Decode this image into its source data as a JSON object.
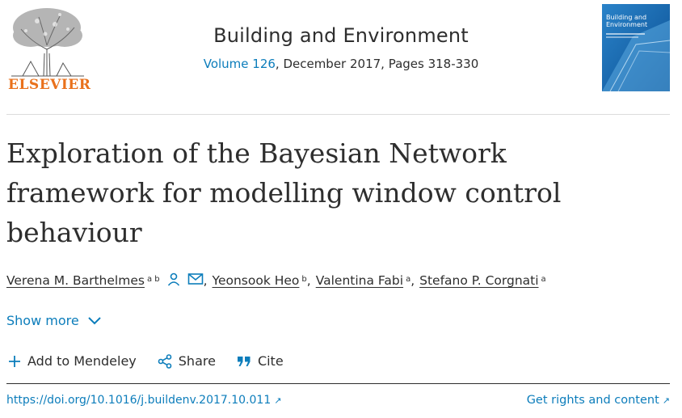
{
  "header": {
    "publisher": "ELSEVIER",
    "journal_title": "Building and Environment",
    "volume_link": "Volume 126",
    "volume_rest": ", December 2017, Pages 318-330",
    "cover_title": "Building and Environment"
  },
  "article": {
    "title": "Exploration of the Bayesian Network framework for modelling window control behaviour",
    "authors": [
      {
        "name": "Verena M. Barthelmes",
        "affil": "a b"
      },
      {
        "name": "Yeonsook Heo",
        "affil": "b"
      },
      {
        "name": "Valentina Fabi",
        "affil": "a"
      },
      {
        "name": "Stefano P. Corgnati",
        "affil": "a"
      }
    ],
    "show_more": "Show more"
  },
  "actions": {
    "mendeley": "Add to Mendeley",
    "share": "Share",
    "cite": "Cite"
  },
  "links": {
    "doi": "https://doi.org/10.1016/j.buildenv.2017.10.011",
    "rights": "Get rights and content",
    "ext_glyph": "↗"
  },
  "colors": {
    "link": "#0c7dbb",
    "publisher_orange": "#e9711c",
    "text": "#2e2e2e"
  },
  "icons": [
    "elsevier-tree-logo",
    "person-icon",
    "envelope-icon",
    "chevron-down-icon",
    "plus-icon",
    "share-icon",
    "quote-icon",
    "external-link-icon"
  ]
}
